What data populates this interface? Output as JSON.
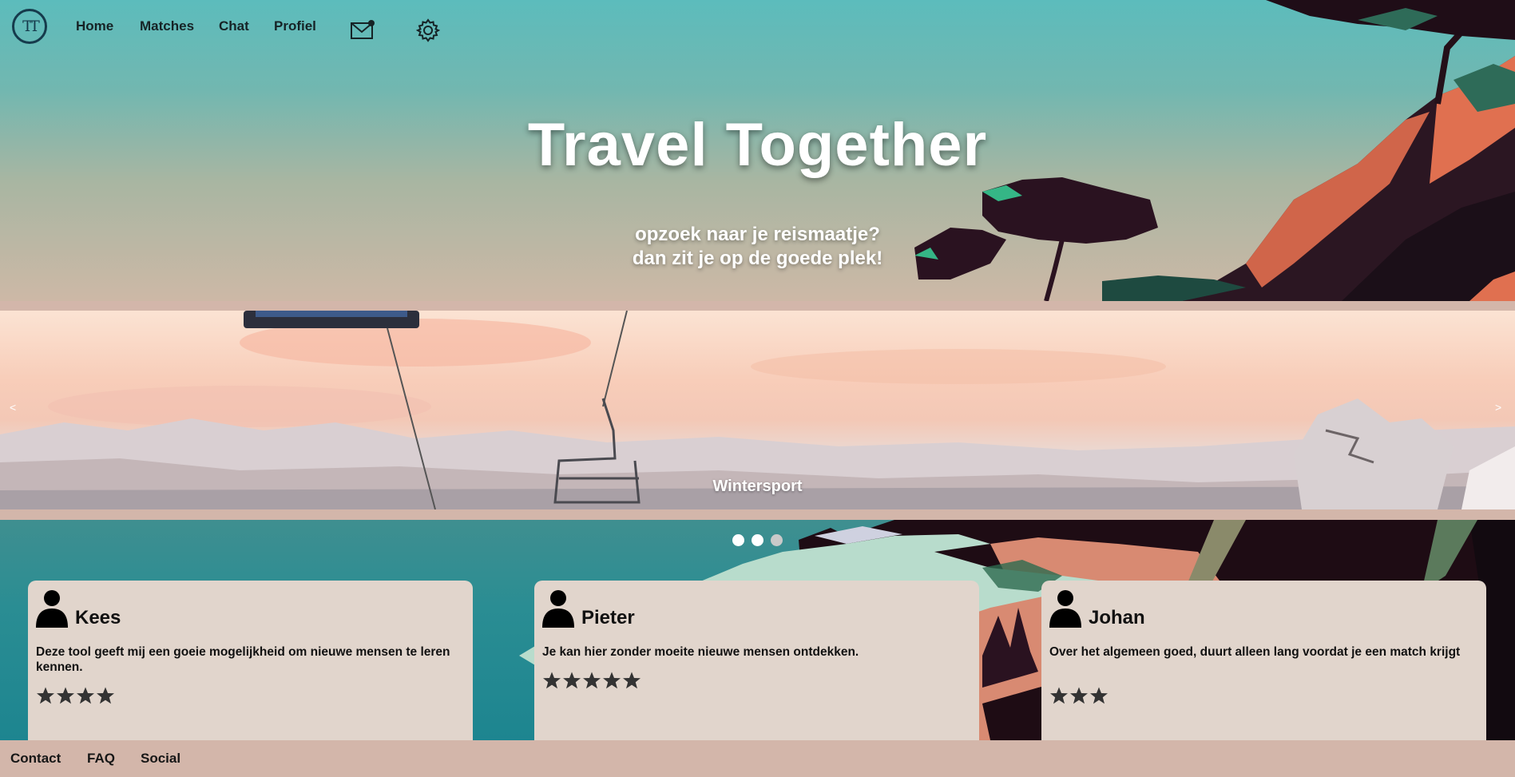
{
  "app": {
    "logo_text": "TT"
  },
  "nav": {
    "items": [
      {
        "label": "Home"
      },
      {
        "label": "Matches"
      },
      {
        "label": "Chat"
      },
      {
        "label": "Profiel"
      }
    ],
    "icons": [
      "mail-icon",
      "gear-icon"
    ]
  },
  "hero": {
    "title": "Travel Together",
    "subtitle_line1": "opzoek naar je reismaatje?",
    "subtitle_line2": "dan zit je op de goede plek!"
  },
  "carousel": {
    "caption": "Wintersport",
    "prev_label": "<",
    "next_label": ">",
    "slide_count": 3,
    "active_slide": 2
  },
  "reviews": [
    {
      "name": "Kees",
      "text": "Deze tool geeft mij een goeie mogelijkheid om nieuwe mensen te leren kennen.",
      "rating": 4
    },
    {
      "name": "Pieter",
      "text": "Je kan hier zonder moeite nieuwe mensen ontdekken.",
      "rating": 5
    },
    {
      "name": "Johan",
      "text": "Over het algemeen goed, duurt alleen lang voordat je een match krijgt",
      "rating": 3
    }
  ],
  "footer": {
    "links": [
      {
        "label": "Contact"
      },
      {
        "label": "FAQ"
      },
      {
        "label": "Social"
      }
    ]
  },
  "colors": {
    "nav_text": "#162326",
    "card_bg": "#e1d5cc",
    "footer_bg": "#d3b6aa",
    "star": "#333333"
  }
}
